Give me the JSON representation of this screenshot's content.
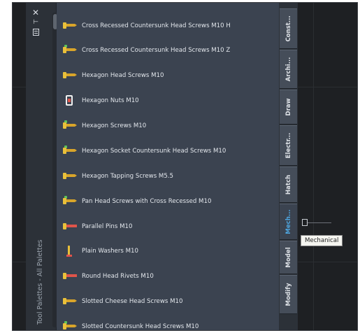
{
  "palette": {
    "title": "Tool Palettes - All Palettes",
    "controls": {
      "close": "✕",
      "pin": "⊢",
      "properties": "properties-icon"
    },
    "tools": [
      {
        "label": "Cross Recessed Countersunk Head Screws M10 H",
        "icon": "screw-icon"
      },
      {
        "label": "Cross Recessed Countersunk Head Screws M10 Z",
        "icon": "screw-icon"
      },
      {
        "label": "Hexagon Head Screws M10",
        "icon": "screw-icon"
      },
      {
        "label": "Hexagon Nuts M10",
        "icon": "nut-icon"
      },
      {
        "label": "Hexagon Screws M10",
        "icon": "screw-icon"
      },
      {
        "label": "Hexagon Socket Countersunk Head Screws M10",
        "icon": "screw-icon"
      },
      {
        "label": "Hexagon Tapping Screws M5.5",
        "icon": "screw-icon"
      },
      {
        "label": "Pan Head Screws with Cross Recessed M10",
        "icon": "screw-icon"
      },
      {
        "label": "Parallel Pins M10",
        "icon": "pin-icon"
      },
      {
        "label": "Plain Washers M10",
        "icon": "washer-icon"
      },
      {
        "label": "Round Head Rivets M10",
        "icon": "rivet-icon"
      },
      {
        "label": "Slotted Cheese Head Screws M10",
        "icon": "screw-icon"
      },
      {
        "label": "Slotted Countersunk Head Screws M10",
        "icon": "screw-icon"
      }
    ]
  },
  "tabs": [
    {
      "label": "Const..."
    },
    {
      "label": "Archi..."
    },
    {
      "label": "Draw"
    },
    {
      "label": "Electr..."
    },
    {
      "label": "Hatch"
    },
    {
      "label": "Mech..."
    },
    {
      "label": "Model"
    },
    {
      "label": "Modify"
    }
  ],
  "active_tab": "Mech...",
  "tooltip": "Mechanical",
  "colors": {
    "accent": "#4ea6e0",
    "panel": "#3b4350",
    "canvas": "#1e2023"
  }
}
